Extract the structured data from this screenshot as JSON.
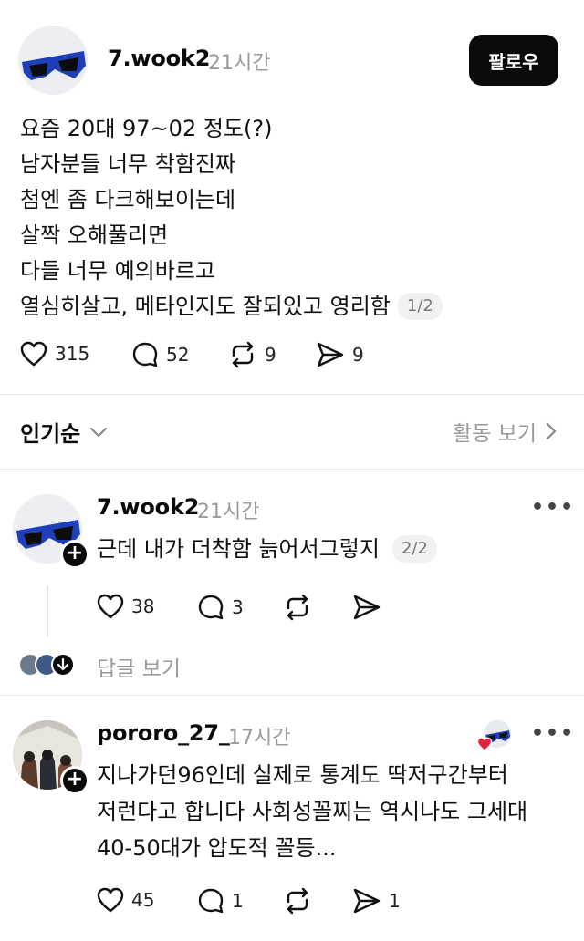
{
  "colors": {
    "text": "#0a0a0a",
    "muted": "#9a9a9a",
    "divider": "#e6e6e6",
    "like_heart": "#e0243c"
  },
  "post": {
    "username": "7.wook2",
    "time": "21시간",
    "follow_label": "팔로우",
    "lines": [
      "요즘 20대 97~02 정도(?)",
      "남자분들 너무 착함진짜",
      "첨엔 좀 다크해보이는데",
      "살짝 오해풀리면",
      "다들 너무 예의바르고",
      "열심히살고, 메타인지도 잘되있고 영리함"
    ],
    "page_indicator": "1/2",
    "likes": "315",
    "comments": "52",
    "reposts": "9",
    "shares": "9"
  },
  "sort": {
    "label": "인기순",
    "activity_label": "활동 보기"
  },
  "reply1": {
    "username": "7.wook2",
    "time": "21시간",
    "text": "근데 내가 더착함 늙어서그렇지",
    "page_indicator": "2/2",
    "likes": "38",
    "comments": "3",
    "view_replies_label": "답글 보기",
    "more": "•••"
  },
  "reply2": {
    "username": "pororo_27_",
    "time": "17시간",
    "lines": [
      "지나가던96인데 실제로 통계도 딱저구간부터",
      "저런다고 합니다 사회성꼴찌는 역시나도 그세대",
      "40-50대가 압도적 꼴등..."
    ],
    "likes": "45",
    "comments": "1",
    "shares": "1",
    "more": "•••"
  },
  "icons": [
    "heart-icon",
    "comment-icon",
    "repost-icon",
    "share-icon",
    "chevron-down-icon",
    "chevron-right-icon",
    "plus-icon",
    "more-icon"
  ]
}
